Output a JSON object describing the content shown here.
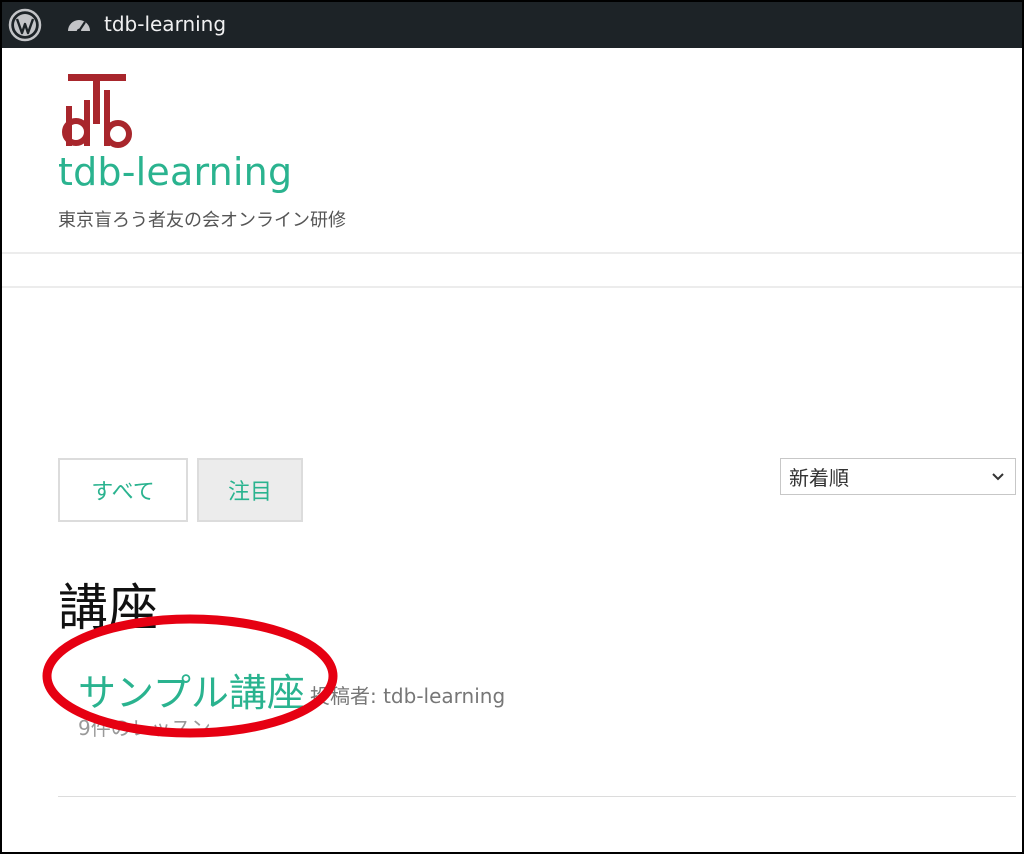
{
  "admin_bar": {
    "site_name": "tdb-learning"
  },
  "header": {
    "site_title": "tdb-learning",
    "tagline": "東京盲ろう者友の会オンライン研修"
  },
  "filters": {
    "tabs": [
      {
        "label": "すべて",
        "active": false
      },
      {
        "label": "注目",
        "active": true
      }
    ],
    "sort": {
      "selected": "新着順"
    }
  },
  "list": {
    "section_title": "講座",
    "courses": [
      {
        "title": "サンプル講座",
        "byline": "投稿者: tdb-learning",
        "lessons": "9件のレッスン"
      }
    ]
  },
  "colors": {
    "accent": "#2ab38f",
    "admin_bar": "#1d2327",
    "logo_red": "#a8262c",
    "highlight_ring": "#e60012"
  },
  "icons": {
    "admin_logo": "wordpress-icon",
    "dashboard": "dashboard-icon",
    "select_chevron": "chevron-down-icon"
  }
}
